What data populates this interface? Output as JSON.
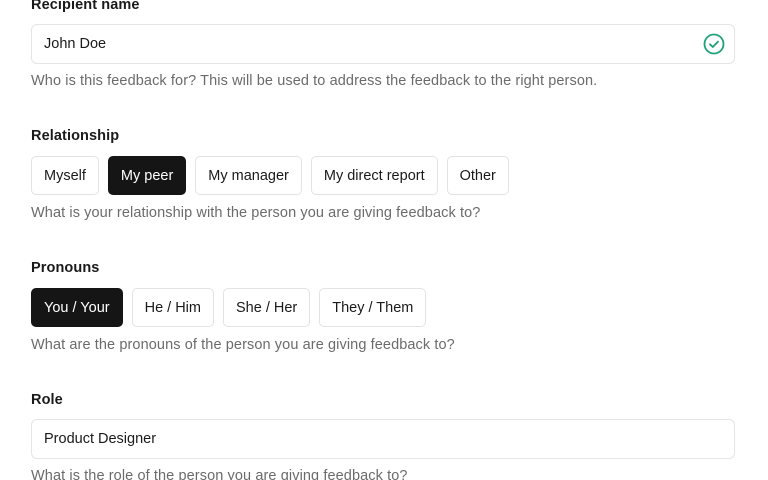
{
  "recipient": {
    "label": "Recipient name",
    "value": "John Doe",
    "valid": true,
    "icon": "check-circle-icon",
    "help": "Who is this feedback for? This will be used to address the feedback to the right person."
  },
  "relationship": {
    "label": "Relationship",
    "options": [
      "Myself",
      "My peer",
      "My manager",
      "My direct report",
      "Other"
    ],
    "selected": "My peer",
    "help": "What is your relationship with the person you are giving feedback to?"
  },
  "pronouns": {
    "label": "Pronouns",
    "options": [
      "You / Your",
      "He / Him",
      "She / Her",
      "They / Them"
    ],
    "selected": "You / Your",
    "help": "What are the pronouns of the person you are giving feedback to?"
  },
  "role": {
    "label": "Role",
    "value": "Product Designer",
    "help": "What is the role of the person you are giving feedback to?"
  },
  "colors": {
    "selected_bg": "#151515",
    "valid_green": "#21a07a"
  }
}
